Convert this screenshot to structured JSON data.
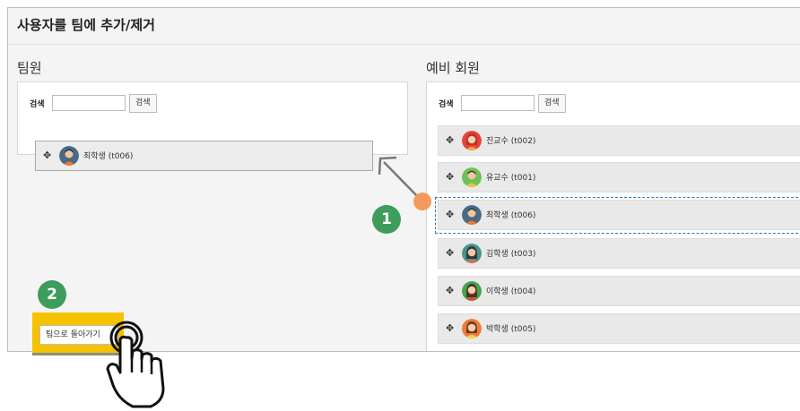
{
  "page_title": "사용자를 팀에 추가/제거",
  "members_panel": {
    "heading": "팀원",
    "search_label": "검색",
    "search_value": "",
    "search_button": "검색",
    "dragged_member": "최학생 (t006)"
  },
  "candidates_panel": {
    "heading": "예비 회원",
    "search_label": "검색",
    "search_value": "",
    "search_button": "검색",
    "items": [
      {
        "name": "진교수 (t002)",
        "avatar": "female-red-hair"
      },
      {
        "name": "유교수 (t001)",
        "avatar": "male-green-shirt"
      },
      {
        "name": "최학생 (t006)",
        "avatar": "male-dark"
      },
      {
        "name": "김학생 (t003)",
        "avatar": "female-teal"
      },
      {
        "name": "이학생 (t004)",
        "avatar": "female-green"
      },
      {
        "name": "박학생 (t005)",
        "avatar": "female-orange"
      }
    ]
  },
  "back_button": "팀으로 돌아가기",
  "steps": {
    "step1": "1",
    "step2": "2"
  },
  "colors": {
    "badge": "#3e9d5b",
    "highlight": "#f5c200",
    "selection_border": "#2b7bbd",
    "pointer_dot": "#f39a5c"
  }
}
